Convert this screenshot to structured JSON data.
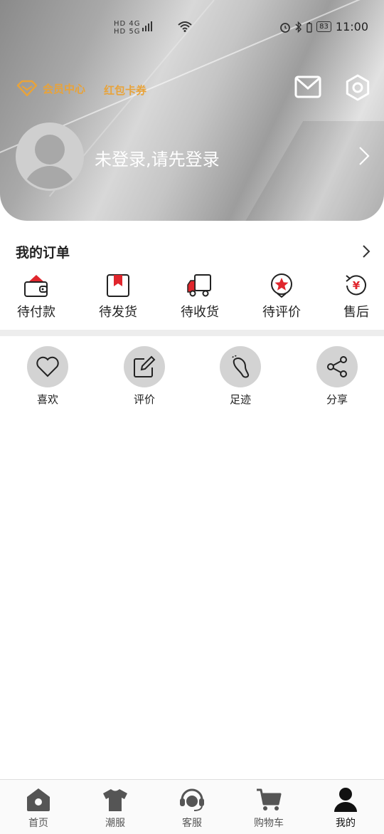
{
  "status_bar": {
    "signal_left": "HD 4G",
    "signal_right": "HD 5G",
    "battery": "83",
    "time": "11:00"
  },
  "header": {
    "member_center": "会员中心",
    "red_packet": "红包卡券",
    "login_prompt": "未登录,请先登录"
  },
  "orders": {
    "title": "我的订单",
    "items": [
      {
        "label": "待付款",
        "icon": "wallet-icon"
      },
      {
        "label": "待发货",
        "icon": "package-icon"
      },
      {
        "label": "待收货",
        "icon": "truck-icon"
      },
      {
        "label": "待评价",
        "icon": "star-badge-icon"
      },
      {
        "label": "售后",
        "icon": "refund-icon"
      }
    ]
  },
  "tools": [
    {
      "label": "喜欢",
      "icon": "heart-icon"
    },
    {
      "label": "评价",
      "icon": "edit-icon"
    },
    {
      "label": "足迹",
      "icon": "footprint-icon"
    },
    {
      "label": "分享",
      "icon": "share-icon"
    }
  ],
  "bottom_nav": [
    {
      "label": "首页",
      "icon": "home-icon",
      "active": false
    },
    {
      "label": "潮服",
      "icon": "tshirt-icon",
      "active": false
    },
    {
      "label": "客服",
      "icon": "headset-icon",
      "active": false
    },
    {
      "label": "购物车",
      "icon": "cart-icon",
      "active": false
    },
    {
      "label": "我的",
      "icon": "user-icon",
      "active": true
    }
  ],
  "colors": {
    "accent_gold": "#e8a33a",
    "accent_red": "#e0262d",
    "nav_icon": "#555555",
    "nav_active": "#111111"
  }
}
